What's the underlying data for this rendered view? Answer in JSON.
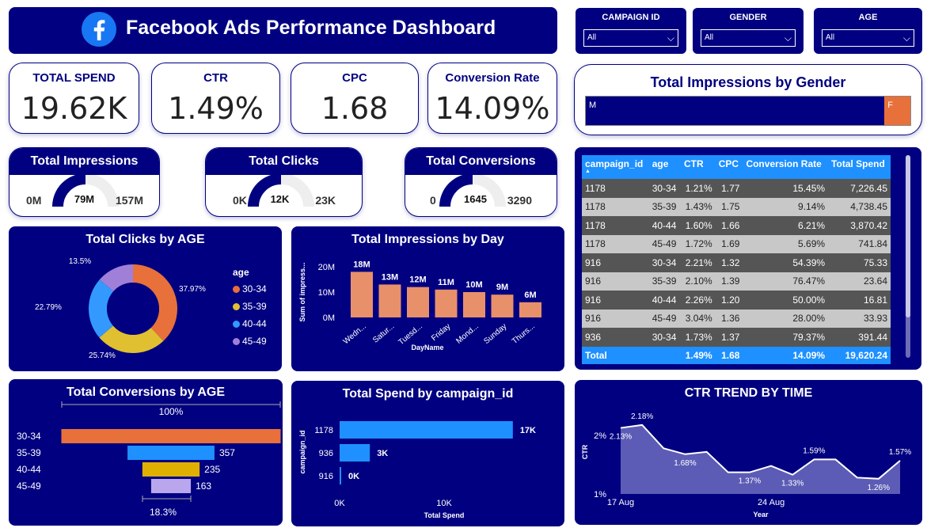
{
  "header": {
    "title": "Facebook Ads Performance Dashboard",
    "logo_icon": "facebook-logo-icon"
  },
  "slicers": [
    {
      "label": "CAMPAIGN ID",
      "value": "All"
    },
    {
      "label": "GENDER",
      "value": "All"
    },
    {
      "label": "AGE",
      "value": "All"
    }
  ],
  "kpis": [
    {
      "label": "TOTAL SPEND",
      "value": "19.62K"
    },
    {
      "label": "CTR",
      "value": "1.49%"
    },
    {
      "label": "CPC",
      "value": "1.68"
    },
    {
      "label": "Conversion Rate",
      "value": "14.09%"
    }
  ],
  "gauges": [
    {
      "title": "Total Impressions",
      "min": "0M",
      "value": "79M",
      "max": "157M",
      "fraction": 0.5
    },
    {
      "title": "Total Clicks",
      "min": "0K",
      "value": "12K",
      "max": "23K",
      "fraction": 0.5
    },
    {
      "title": "Total Conversions",
      "min": "0",
      "value": "1645",
      "max": "3290",
      "fraction": 0.5
    }
  ],
  "gender_bar": {
    "title": "Total Impressions by Gender",
    "segments": [
      {
        "label": "M",
        "share": 0.9,
        "color": "#010080"
      },
      {
        "label": "F",
        "share": 0.1,
        "color": "#e8703a"
      }
    ]
  },
  "table": {
    "columns": [
      "campaign_id",
      "age",
      "CTR",
      "CPC",
      "Conversion Rate",
      "Total Spend"
    ],
    "sort_indicator": "▲",
    "rows": [
      [
        "1178",
        "30-34",
        "1.21%",
        "1.77",
        "15.45%",
        "7,226.45"
      ],
      [
        "1178",
        "35-39",
        "1.43%",
        "1.75",
        "9.14%",
        "4,738.45"
      ],
      [
        "1178",
        "40-44",
        "1.60%",
        "1.66",
        "6.21%",
        "3,870.42"
      ],
      [
        "1178",
        "45-49",
        "1.72%",
        "1.69",
        "5.69%",
        "741.84"
      ],
      [
        "916",
        "30-34",
        "2.21%",
        "1.32",
        "54.39%",
        "75.33"
      ],
      [
        "916",
        "35-39",
        "2.10%",
        "1.39",
        "76.47%",
        "23.64"
      ],
      [
        "916",
        "40-44",
        "2.26%",
        "1.20",
        "50.00%",
        "16.81"
      ],
      [
        "916",
        "45-49",
        "3.04%",
        "1.36",
        "28.00%",
        "33.93"
      ],
      [
        "936",
        "30-34",
        "1.73%",
        "1.37",
        "79.37%",
        "391.44"
      ]
    ],
    "total": [
      "Total",
      "",
      "1.49%",
      "1.68",
      "14.09%",
      "19,620.24"
    ]
  },
  "colors": {
    "navy": "#010080",
    "orange": "#e8703a",
    "blue": "#1e90ff",
    "bar_salmon": "#e8906a"
  },
  "chart_data": [
    {
      "id": "clicks-by-age",
      "type": "pie",
      "title": "Total Clicks by AGE",
      "legend_title": "age",
      "categories": [
        "30-34",
        "35-39",
        "40-44",
        "45-49"
      ],
      "values": [
        37.97,
        25.74,
        22.79,
        13.5
      ],
      "labels": [
        "37.97%",
        "25.74%",
        "22.79%",
        "13.5%"
      ],
      "colors": [
        "#e8703a",
        "#e0c030",
        "#3399ff",
        "#9f7fd8"
      ]
    },
    {
      "id": "impressions-by-day",
      "type": "bar",
      "title": "Total Impressions by Day",
      "xlabel": "DayName",
      "ylabel": "Sum of impress...",
      "categories": [
        "Wedn...",
        "Satur...",
        "Tuesd...",
        "Friday",
        "Mond...",
        "Sunday",
        "Thurs..."
      ],
      "values": [
        18,
        13,
        12,
        11,
        10,
        9,
        6
      ],
      "labels": [
        "18M",
        "13M",
        "12M",
        "11M",
        "10M",
        "9M",
        "6M"
      ],
      "yticks": [
        "0M",
        "10M",
        "20M"
      ],
      "ylim": [
        0,
        20
      ]
    },
    {
      "id": "conversions-by-age",
      "type": "bar",
      "title": "Total Conversions by AGE",
      "categories": [
        "30-34",
        "35-39",
        "40-44",
        "45-49"
      ],
      "values": [
        900,
        357,
        235,
        163
      ],
      "labels": [
        "",
        "357",
        "235",
        "163"
      ],
      "top_label": "100%",
      "bottom_label": "18.3%",
      "colors": [
        "#e8703a",
        "#1e90ff",
        "#e0b000",
        "#b9a6ec"
      ]
    },
    {
      "id": "spend-by-campaign",
      "type": "bar",
      "title": "Total Spend by campaign_id",
      "xlabel": "Total Spend",
      "ylabel": "campaign_id",
      "categories": [
        "1178",
        "936",
        "916"
      ],
      "values": [
        16577,
        2893,
        150
      ],
      "labels": [
        "17K",
        "3K",
        "0K"
      ],
      "xticks": [
        "0K",
        "10K"
      ],
      "xlim": [
        0,
        20000
      ]
    },
    {
      "id": "ctr-trend",
      "type": "area",
      "title": "CTR TREND BY TIME",
      "xlabel": "Year",
      "ylabel": "CTR",
      "x": [
        "17 Aug",
        "18 Aug",
        "19 Aug",
        "20 Aug",
        "21 Aug",
        "22 Aug",
        "23 Aug",
        "24 Aug",
        "25 Aug",
        "26 Aug",
        "27 Aug",
        "28 Aug",
        "29 Aug",
        "30 Aug"
      ],
      "y": [
        2.13,
        2.18,
        1.78,
        1.68,
        1.72,
        1.37,
        1.37,
        1.48,
        1.33,
        1.59,
        1.59,
        1.28,
        1.26,
        1.57
      ],
      "point_labels": {
        "0": "2.13%",
        "1": "2.18%",
        "3": "1.68%",
        "6": "1.37%",
        "8": "1.33%",
        "9": "1.59%",
        "12": "1.26%",
        "13": "1.57%"
      },
      "xticks": [
        "17 Aug",
        "24 Aug"
      ],
      "yticks": [
        "1%",
        "2%"
      ],
      "ylim": [
        1,
        2.3
      ]
    }
  ]
}
